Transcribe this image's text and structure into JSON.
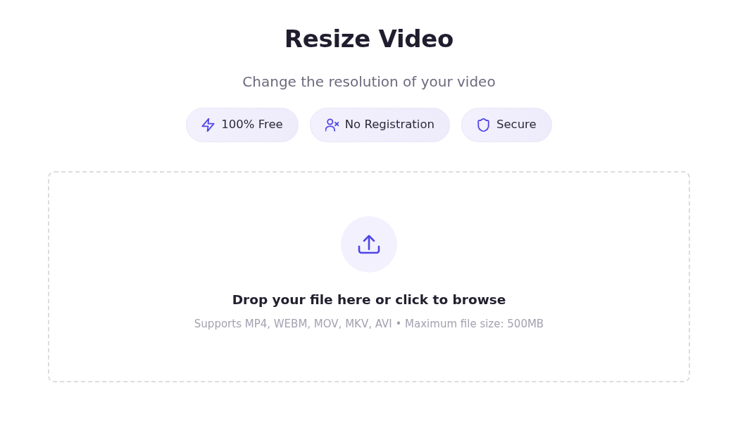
{
  "header": {
    "title": "Resize Video",
    "subtitle": "Change the resolution of your video"
  },
  "features": [
    {
      "kind": "bolt",
      "label": "100% Free"
    },
    {
      "kind": "user",
      "label": "No Registration"
    },
    {
      "kind": "shield",
      "label": "Secure"
    }
  ],
  "dropzone": {
    "prompt": "Drop your file here or click to browse",
    "hint": "Supports MP4, WEBM, MOV, MKV, AVI • Maximum file size: 500MB"
  }
}
